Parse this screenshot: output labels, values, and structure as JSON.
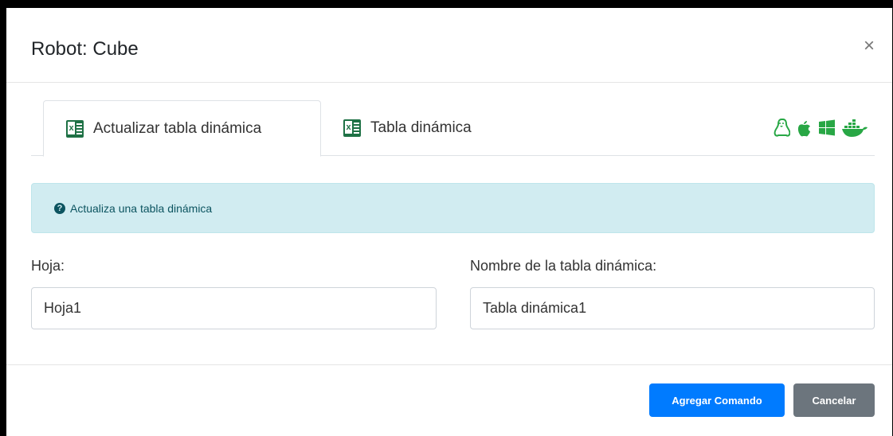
{
  "modal": {
    "title": "Robot: Cube",
    "close_label": "×"
  },
  "tabs": [
    {
      "label": "Actualizar tabla dinámica",
      "icon": "excel-icon",
      "active": true
    },
    {
      "label": "Tabla dinámica",
      "icon": "excel-icon",
      "active": false
    }
  ],
  "os_icons": [
    "linux-icon",
    "apple-icon",
    "windows-icon",
    "docker-icon"
  ],
  "colors": {
    "os_green": "#28a745",
    "excel_green": "#1e7145",
    "primary": "#007bff",
    "secondary": "#6c757d",
    "info_bg": "#d1ecf1",
    "info_text": "#0c5460"
  },
  "alert": {
    "icon": "question-circle-icon",
    "text": "Actualiza una tabla dinámica"
  },
  "form": {
    "sheet": {
      "label": "Hoja:",
      "value": "Hoja1"
    },
    "pivot_name": {
      "label": "Nombre de la tabla dinámica:",
      "value": "Tabla dinámica1"
    }
  },
  "footer": {
    "submit_label": "Agregar Comando",
    "cancel_label": "Cancelar"
  }
}
